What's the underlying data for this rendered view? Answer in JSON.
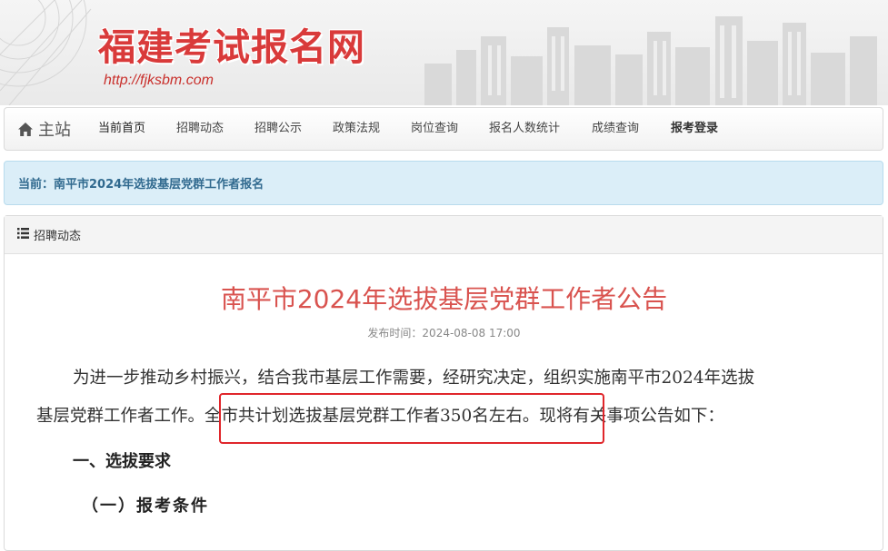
{
  "header": {
    "site_title": "福建考试报名网",
    "site_url": "http://fjksbm.com",
    "title_color": "#d93a3a"
  },
  "nav": {
    "home_icon": "home-icon",
    "home_label": "主站",
    "items": [
      {
        "label": "当前首页",
        "style": "active"
      },
      {
        "label": "招聘动态",
        "style": "normal"
      },
      {
        "label": "招聘公示",
        "style": "normal"
      },
      {
        "label": "政策法规",
        "style": "normal"
      },
      {
        "label": "岗位查询",
        "style": "normal"
      },
      {
        "label": "报名人数统计",
        "style": "normal"
      },
      {
        "label": "成绩查询",
        "style": "normal"
      },
      {
        "label": "报考登录",
        "style": "bold"
      }
    ]
  },
  "breadcrumb": {
    "text": "当前：南平市2024年选拔基层党群工作者报名"
  },
  "panel": {
    "icon": "list-icon",
    "label": "招聘动态"
  },
  "article": {
    "title": "南平市2024年选拔基层党群工作者公告",
    "meta": "发布时间：2024-08-08 17:00",
    "para1_line1": "为进一步推动乡村振兴，结合我市基层工作需要，经研究决定，组织实施南平市2024年选拔",
    "para1_line2_before": "基层党群工作者工作。",
    "para1_line2_highlight": "全市共计划选拔基层党群工作者350名左右。",
    "para1_line2_after": "现将有关事项公告如下：",
    "section1": "一、选拔要求",
    "section1_1": "（一）报考条件",
    "title_color": "#d9534f",
    "highlight_color": "#e0262b"
  }
}
